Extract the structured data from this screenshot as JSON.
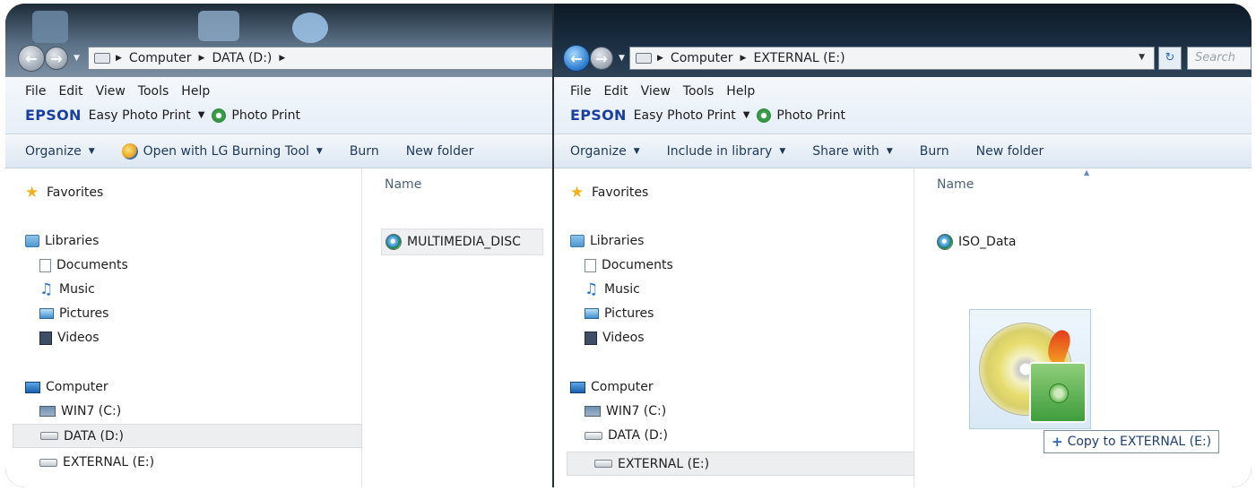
{
  "left_window": {
    "breadcrumb": [
      "Computer",
      "DATA (D:)"
    ],
    "menu": [
      "File",
      "Edit",
      "View",
      "Tools",
      "Help"
    ],
    "epson": {
      "brand": "EPSON",
      "app": "Easy Photo Print",
      "photo_print": "Photo Print"
    },
    "commands": {
      "organize": "Organize",
      "open_with": "Open with LG Burning Tool",
      "burn": "Burn",
      "new_folder": "New folder"
    },
    "nav": {
      "favorites": "Favorites",
      "libraries": "Libraries",
      "documents": "Documents",
      "music": "Music",
      "pictures": "Pictures",
      "videos": "Videos",
      "computer": "Computer",
      "win7": "WIN7 (C:)",
      "data": "DATA (D:)",
      "external": "EXTERNAL (E:)"
    },
    "column_header": "Name",
    "files": [
      "MULTIMEDIA_DISC"
    ]
  },
  "right_window": {
    "breadcrumb": [
      "Computer",
      "EXTERNAL (E:)"
    ],
    "search_placeholder": "Search",
    "menu": [
      "File",
      "Edit",
      "View",
      "Tools",
      "Help"
    ],
    "epson": {
      "brand": "EPSON",
      "app": "Easy Photo Print",
      "photo_print": "Photo Print"
    },
    "commands": {
      "organize": "Organize",
      "include": "Include in library",
      "share": "Share with",
      "burn": "Burn",
      "new_folder": "New folder"
    },
    "nav": {
      "favorites": "Favorites",
      "libraries": "Libraries",
      "documents": "Documents",
      "music": "Music",
      "pictures": "Pictures",
      "videos": "Videos",
      "computer": "Computer",
      "win7": "WIN7 (C:)",
      "data": "DATA (D:)",
      "external": "EXTERNAL (E:)"
    },
    "column_header": "Name",
    "files": [
      "ISO_Data"
    ],
    "drag_tooltip": "Copy to EXTERNAL (E:)"
  }
}
